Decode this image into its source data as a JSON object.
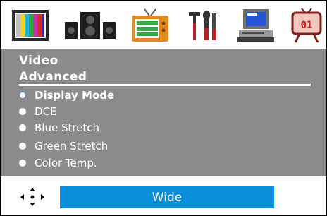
{
  "icons": [
    {
      "name": "picture-icon",
      "selected": false
    },
    {
      "name": "audio-speakers-icon",
      "selected": false
    },
    {
      "name": "tv-icon",
      "selected": false
    },
    {
      "name": "tools-icon",
      "selected": false
    },
    {
      "name": "pc-icon",
      "selected": false
    },
    {
      "name": "timer-icon",
      "selected": false
    }
  ],
  "menu": {
    "title": "Video",
    "subtitle": "Advanced",
    "items": [
      {
        "label": "Display Mode",
        "active": true
      },
      {
        "label": "DCE",
        "active": false
      },
      {
        "label": "Blue Stretch",
        "active": false
      },
      {
        "label": "Green Stretch",
        "active": false
      },
      {
        "label": "Color Temp.",
        "active": false
      }
    ]
  },
  "bottom": {
    "nav_icon": "four-way-nav-icon",
    "value": "Wide"
  },
  "colors": {
    "panel": "#8b8b8b",
    "value_box": "#0a8fdc",
    "text": "#ffffff"
  }
}
